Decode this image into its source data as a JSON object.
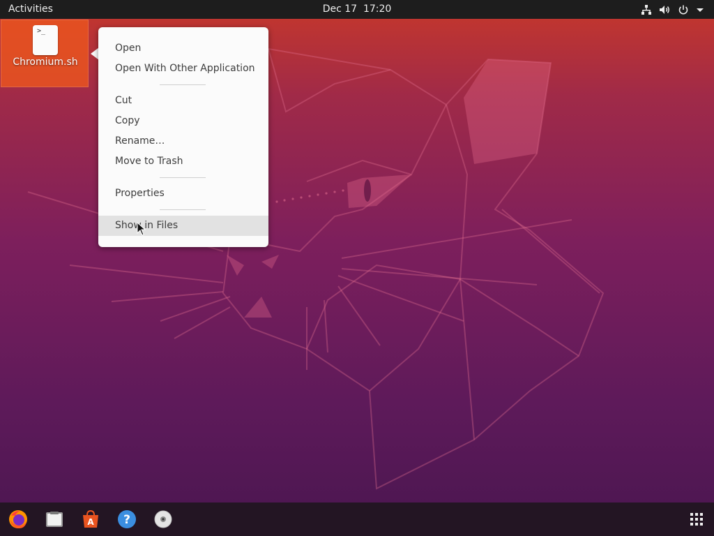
{
  "topbar": {
    "activities_label": "Activities",
    "date": "Dec 17",
    "time": "17:20",
    "icons": [
      "network-icon",
      "volume-icon",
      "power-icon",
      "system-menu-arrow-icon"
    ]
  },
  "desktop": {
    "icon_label": "Chromium.sh",
    "icon_glyph": ">_"
  },
  "context_menu": {
    "items": [
      {
        "label": "Open"
      },
      {
        "label": "Open With Other Application"
      },
      {
        "label": "Cut"
      },
      {
        "label": "Copy"
      },
      {
        "label": "Rename…"
      },
      {
        "label": "Move to Trash"
      },
      {
        "label": "Properties"
      },
      {
        "label": "Show in Files"
      }
    ],
    "hovered_item": "Show in Files"
  },
  "dock": {
    "apps": [
      {
        "name": "Firefox",
        "icon": "firefox-icon"
      },
      {
        "name": "Files",
        "icon": "files-icon"
      },
      {
        "name": "Ubuntu Software",
        "icon": "software-icon"
      },
      {
        "name": "Help",
        "icon": "help-icon",
        "glyph": "?"
      },
      {
        "name": "Disc",
        "icon": "disc-icon"
      }
    ],
    "apps_grid_icon": "show-applications-icon"
  },
  "colors": {
    "accent": "#e95420",
    "topbar": "#1d1d1d",
    "menu_bg": "#fbfbfb"
  }
}
